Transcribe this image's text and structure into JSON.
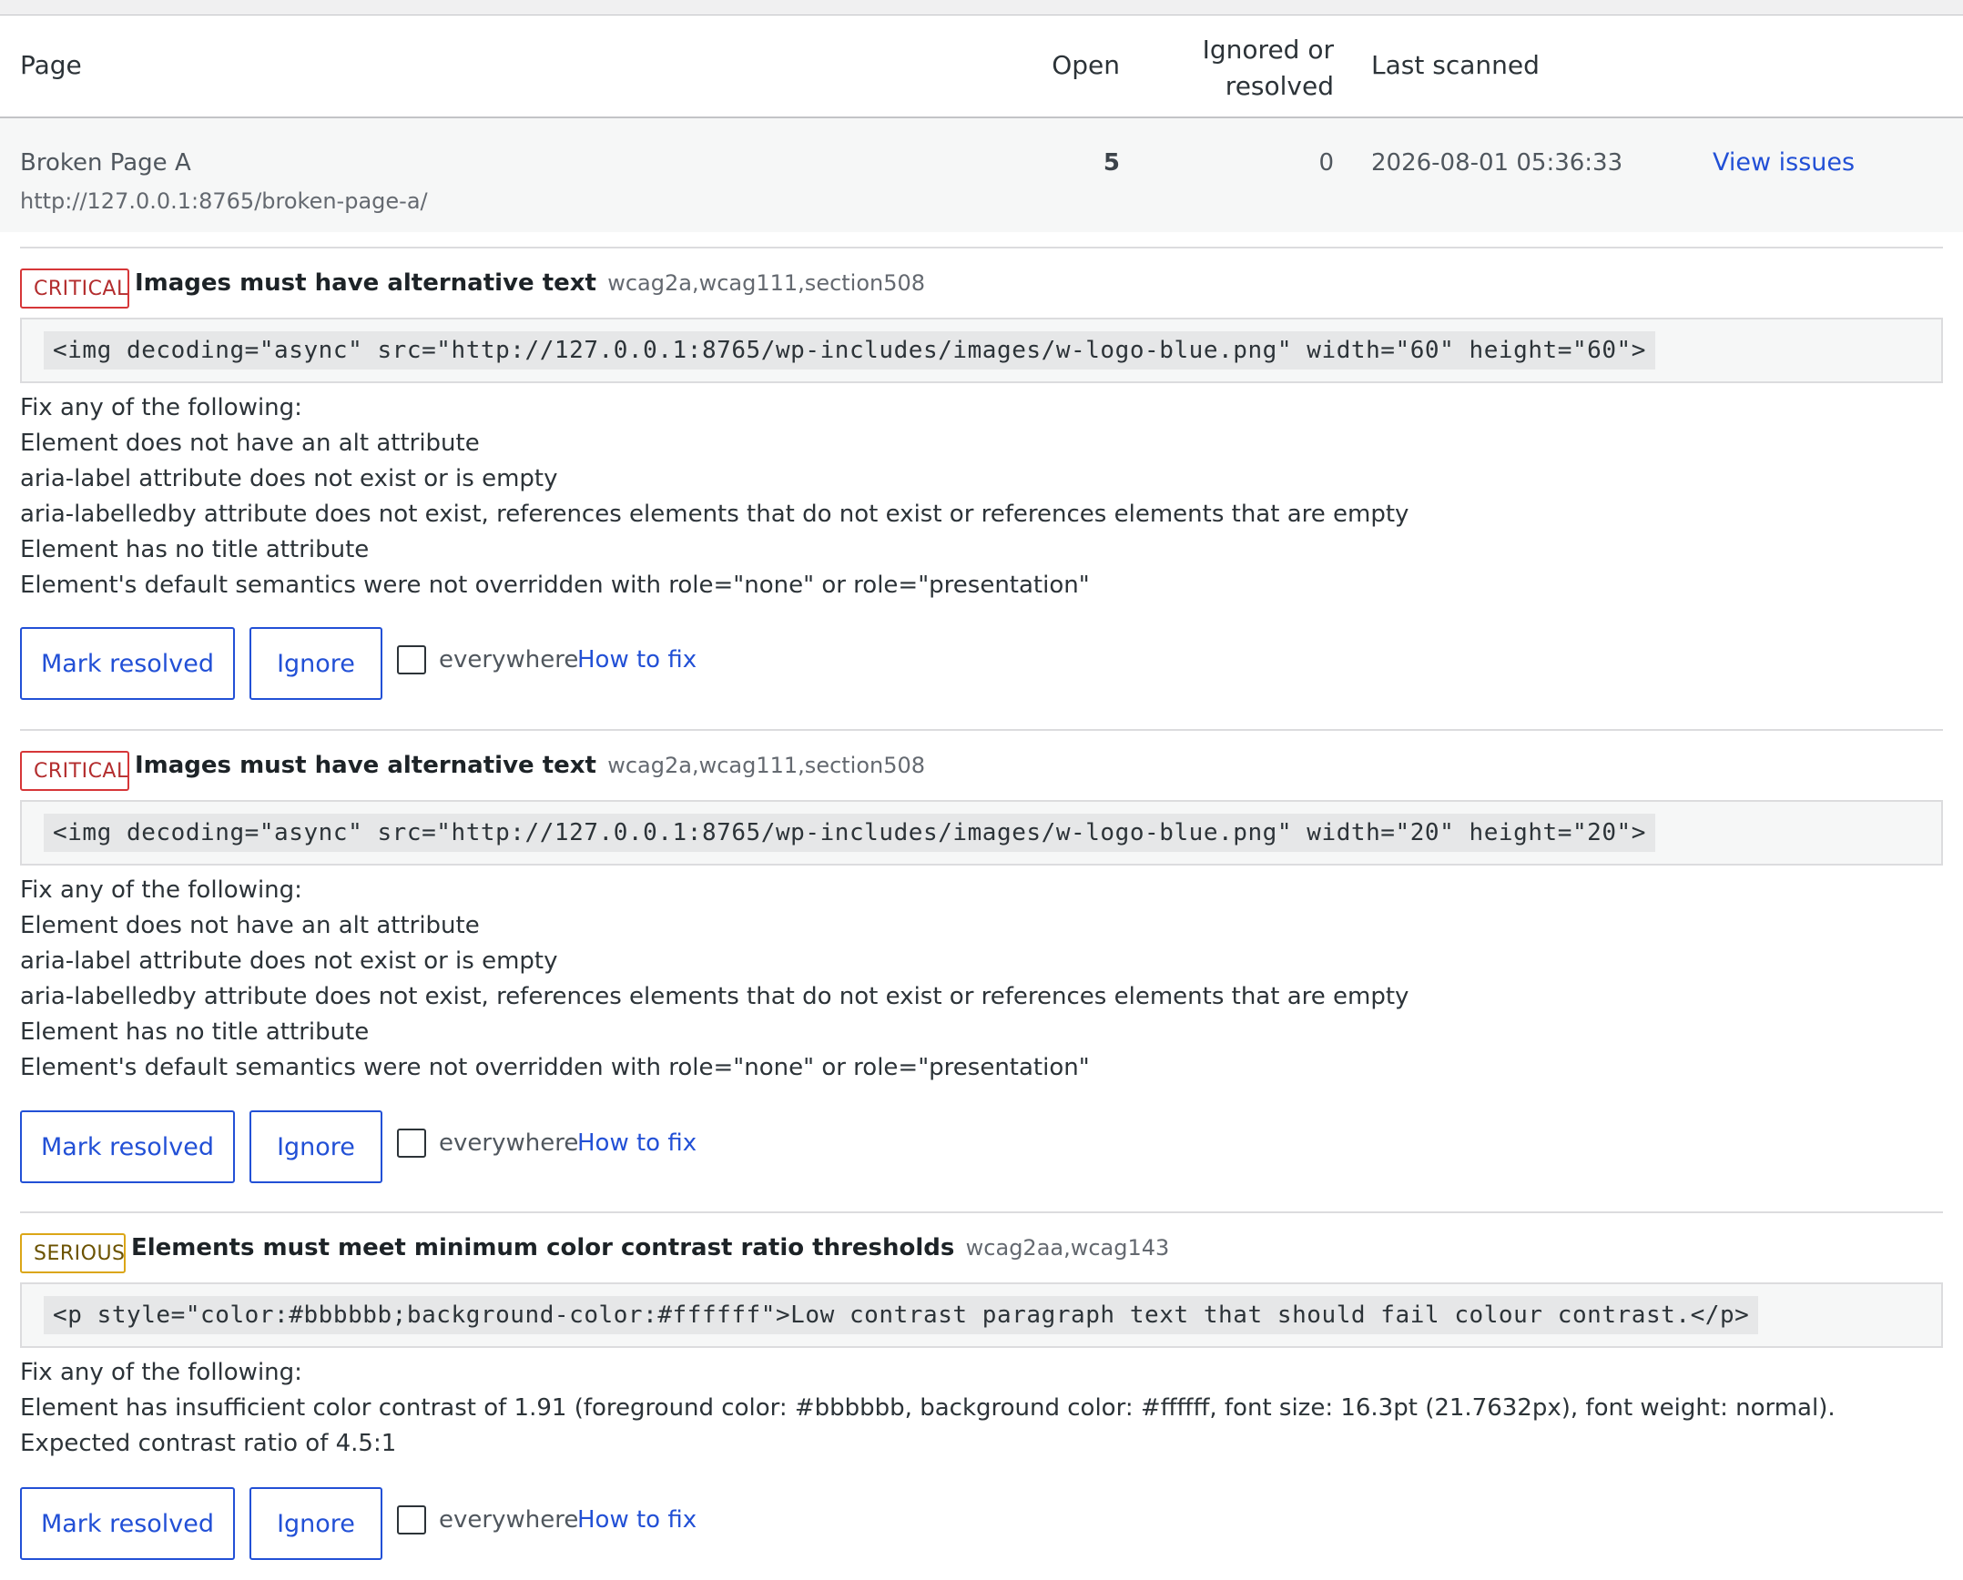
{
  "table": {
    "headers": {
      "page": "Page",
      "open": "Open",
      "ignored_line1": "Ignored or",
      "ignored_line2": "resolved",
      "last_scanned": "Last scanned"
    },
    "row": {
      "title": "Broken Page A",
      "url": "http://127.0.0.1:8765/broken-page-a/",
      "open": "5",
      "ignored": "0",
      "last_scanned": "2026-08-01 05:36:33",
      "view_link": "View issues"
    }
  },
  "issues": [
    {
      "severity": "CRITICAL",
      "title": "Images must have alternative text",
      "tags": "wcag2a,wcag111,section508",
      "code": "<img decoding=\"async\" src=\"http://127.0.0.1:8765/wp-includes/images/w-logo-blue.png\" width=\"60\" height=\"60\">",
      "fix_intro": "Fix any of the following:",
      "fixes": [
        "Element does not have an alt attribute",
        "aria-label attribute does not exist or is empty",
        "aria-labelledby attribute does not exist, references elements that do not exist or references elements that are empty",
        "Element has no title attribute",
        "Element's default semantics were not overridden with role=\"none\" or role=\"presentation\""
      ]
    },
    {
      "severity": "CRITICAL",
      "title": "Images must have alternative text",
      "tags": "wcag2a,wcag111,section508",
      "code": "<img decoding=\"async\" src=\"http://127.0.0.1:8765/wp-includes/images/w-logo-blue.png\" width=\"20\" height=\"20\">",
      "fix_intro": "Fix any of the following:",
      "fixes": [
        "Element does not have an alt attribute",
        "aria-label attribute does not exist or is empty",
        "aria-labelledby attribute does not exist, references elements that do not exist or references elements that are empty",
        "Element has no title attribute",
        "Element's default semantics were not overridden with role=\"none\" or role=\"presentation\""
      ]
    },
    {
      "severity": "SERIOUS",
      "title": "Elements must meet minimum color contrast ratio thresholds",
      "tags": "wcag2aa,wcag143",
      "code": "<p style=\"color:#bbbbbb;background-color:#ffffff\">Low contrast paragraph text that should fail colour contrast.</p>",
      "fix_intro": "Fix any of the following:",
      "fixes": [
        "Element has insufficient color contrast of 1.91 (foreground color: #bbbbbb, background color: #ffffff, font size: 16.3pt (21.7632px), font weight: normal). Expected contrast ratio of 4.5:1"
      ]
    }
  ],
  "actions": {
    "resolve_label": "Mark resolved",
    "ignore_label": "Ignore",
    "everywhere_label": "everywhere",
    "howto_label": "How to fix"
  },
  "colors": {
    "link": "#2250d6",
    "critical": "#d63638",
    "serious": "#dba617"
  }
}
